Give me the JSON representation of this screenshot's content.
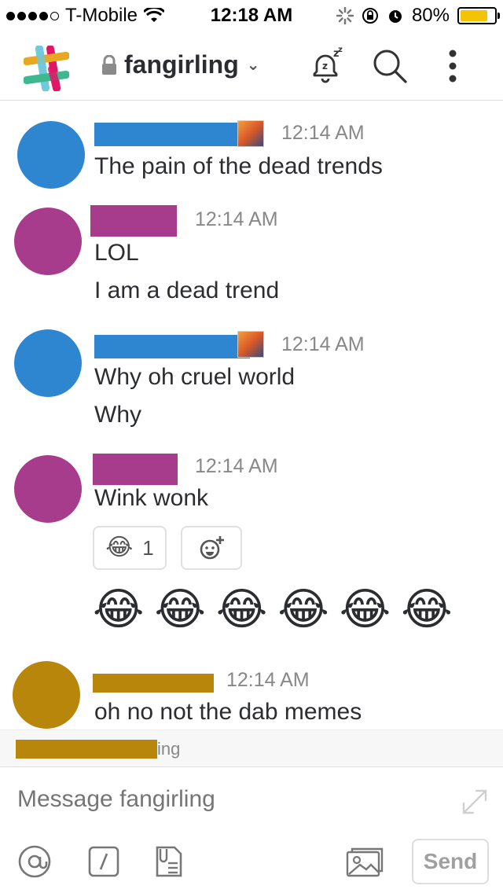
{
  "status_bar": {
    "carrier": "T-Mobile",
    "time": "12:18 AM",
    "battery": "80%",
    "battery_level": 0.8
  },
  "header": {
    "channel_name": "fangirling",
    "icons": [
      "slack-logo",
      "lock-icon",
      "chevron-down-icon",
      "snooze-bell-icon",
      "search-icon",
      "more-vertical-icon"
    ]
  },
  "messages": [
    {
      "time": "12:14 AM",
      "lines": [
        "The pain of the dead trends"
      ],
      "avatar_color": "#2e86d1",
      "name_color": "#2e86d1"
    },
    {
      "time": "12:14 AM",
      "lines": [
        "LOL",
        "I am a dead trend"
      ],
      "avatar_color": "#a83c8c",
      "name_color": "#a83c8c"
    },
    {
      "time": "12:14 AM",
      "lines": [
        "Why oh cruel world",
        "Why"
      ],
      "avatar_color": "#2e86d1",
      "name_color": "#2e86d1"
    },
    {
      "time": "12:14 AM",
      "lines": [
        "Wink wonk"
      ],
      "avatar_color": "#a83c8c",
      "name_color": "#a83c8c",
      "reactions": [
        {
          "emoji": "😂",
          "count": "1"
        }
      ],
      "big_emojis": [
        "😂",
        "😂",
        "😂",
        "😂",
        "😂",
        "😂"
      ]
    },
    {
      "time": "12:14 AM",
      "lines": [
        "oh no not the dab memes"
      ],
      "avatar_color": "#b8860b",
      "name_color": "#b8860b"
    }
  ],
  "typing": {
    "suffix": "ing"
  },
  "composer": {
    "placeholder": "Message fangirling",
    "send_label": "Send"
  }
}
